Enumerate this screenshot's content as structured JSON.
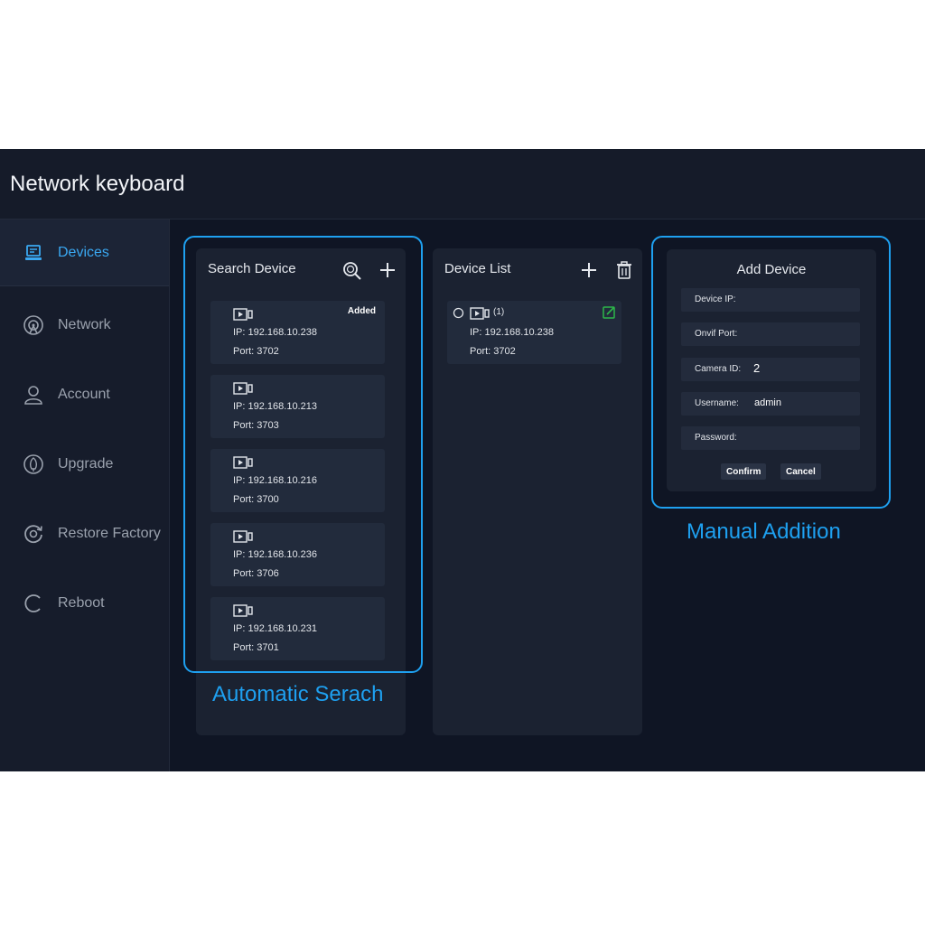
{
  "app": {
    "title": "Network keyboard"
  },
  "sidebar": {
    "items": [
      {
        "label": "Devices",
        "icon": "devices-icon",
        "active": true
      },
      {
        "label": "Network",
        "icon": "network-icon"
      },
      {
        "label": "Account",
        "icon": "account-icon"
      },
      {
        "label": "Upgrade",
        "icon": "upgrade-icon"
      },
      {
        "label": "Restore Factory",
        "icon": "restore-icon"
      },
      {
        "label": "Reboot",
        "icon": "reboot-icon"
      }
    ]
  },
  "search_panel": {
    "title": "Search Device",
    "devices": [
      {
        "ip": "IP: 192.168.10.238",
        "port": "Port: 3702",
        "badge": "Added"
      },
      {
        "ip": "IP: 192.168.10.213",
        "port": "Port: 3703"
      },
      {
        "ip": "IP: 192.168.10.216",
        "port": "Port: 3700"
      },
      {
        "ip": "IP: 192.168.10.236",
        "port": "Port: 3706"
      },
      {
        "ip": "IP: 192.168.10.231",
        "port": "Port: 3701"
      }
    ]
  },
  "device_list": {
    "title": "Device List",
    "devices": [
      {
        "index": "(1)",
        "ip": "IP: 192.168.10.238",
        "port": "Port: 3702"
      }
    ]
  },
  "add_device": {
    "title": "Add Device",
    "fields": [
      {
        "label": "Device IP:",
        "value": ""
      },
      {
        "label": "Onvif Port:",
        "value": ""
      },
      {
        "label": "Camera ID:",
        "value": "2"
      },
      {
        "label": "Username:",
        "value": "admin"
      },
      {
        "label": "Password:",
        "value": ""
      }
    ],
    "confirm_label": "Confirm",
    "cancel_label": "Cancel"
  },
  "annotations": {
    "auto_search": "Automatic Serach",
    "manual_addition": "Manual Addition"
  },
  "colors": {
    "accent": "#1ea0f0",
    "active_nav": "#3aa8f2",
    "edit_icon": "#2db84a"
  }
}
